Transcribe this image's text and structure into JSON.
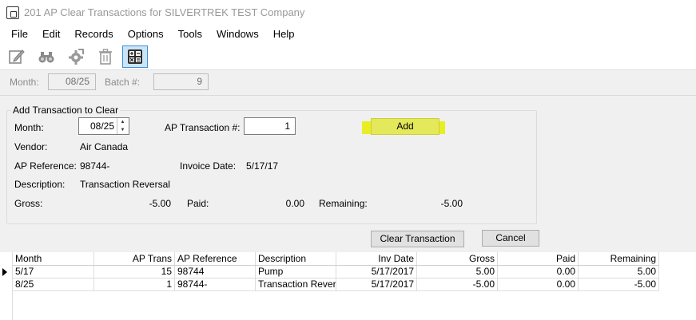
{
  "window": {
    "title": "201 AP Clear Transactions for SILVERTREK TEST Company"
  },
  "menu": [
    "File",
    "Edit",
    "Records",
    "Options",
    "Tools",
    "Windows",
    "Help"
  ],
  "toolbar": {
    "icons": [
      "edit-icon",
      "binoculars-icon",
      "settings-icon",
      "trash-icon",
      "calculator-icon"
    ],
    "active": "calculator-icon"
  },
  "filter": {
    "month_label": "Month:",
    "month_value": "08/25",
    "batch_label": "Batch #:",
    "batch_value": "9"
  },
  "form": {
    "group_title": "Add Transaction to Clear",
    "month_label": "Month:",
    "month_value": "08/25",
    "ap_trans_label": "AP Transaction #:",
    "ap_trans_value": "1",
    "add_label": "Add",
    "vendor_label": "Vendor:",
    "vendor_value": "Air Canada",
    "ap_ref_label": "AP Reference:",
    "ap_ref_value": "98744-",
    "invoice_date_label": "Invoice Date:",
    "invoice_date_value": "5/17/17",
    "description_label": "Description:",
    "description_value": "Transaction Reversal",
    "gross_label": "Gross:",
    "gross_value": "-5.00",
    "paid_label": "Paid:",
    "paid_value": "0.00",
    "remaining_label": "Remaining:",
    "remaining_value": "-5.00",
    "clear_label": "Clear Transaction",
    "cancel_label": "Cancel"
  },
  "grid": {
    "columns": [
      "Month",
      "AP Trans",
      "AP Reference",
      "Description",
      "Inv Date",
      "Gross",
      "Paid",
      "Remaining"
    ],
    "rows": [
      [
        "5/17",
        "15",
        "98744",
        "Pump",
        "5/17/2017",
        "5.00",
        "0.00",
        "5.00"
      ],
      [
        "8/25",
        "1",
        "98744-",
        "Transaction Reversa",
        "5/17/2017",
        "-5.00",
        "0.00",
        "-5.00"
      ]
    ],
    "current_row": 0
  },
  "colors": {
    "highlight": "#e7ec00",
    "active_tool": "#cce4f7"
  }
}
